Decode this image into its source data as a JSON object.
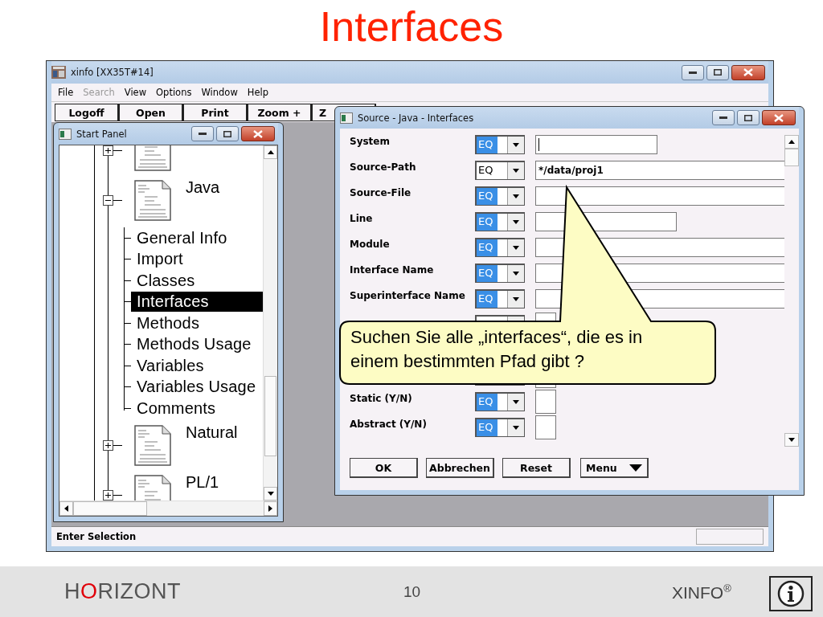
{
  "slide_title": "Interfaces",
  "main_window": {
    "title": "xinfo [XX35T#14]",
    "menu": [
      {
        "label": "File",
        "disabled": false
      },
      {
        "label": "Search",
        "disabled": true
      },
      {
        "label": "View",
        "disabled": false
      },
      {
        "label": "Options",
        "disabled": false
      },
      {
        "label": "Window",
        "disabled": false
      },
      {
        "label": "Help",
        "disabled": false
      }
    ],
    "toolbar": [
      "Logoff",
      "Open",
      "Print",
      "Zoom +",
      "Z"
    ],
    "status_bar": "Enter Selection"
  },
  "start_panel": {
    "title": "Start Panel",
    "tree": [
      {
        "expanded": false
      },
      {
        "label": "Java",
        "expanded": true,
        "children": [
          {
            "label": "General Info",
            "selected": false
          },
          {
            "label": "Import",
            "selected": false
          },
          {
            "label": "Classes",
            "selected": false
          },
          {
            "label": "Interfaces",
            "selected": true
          },
          {
            "label": "Methods",
            "selected": false
          },
          {
            "label": "Methods Usage",
            "selected": false
          },
          {
            "label": "Variables",
            "selected": false
          },
          {
            "label": "Variables Usage",
            "selected": false
          },
          {
            "label": "Comments",
            "selected": false
          }
        ]
      },
      {
        "label": "Natural",
        "expanded": false
      },
      {
        "label": "PL/1",
        "expanded": false
      }
    ]
  },
  "source_window": {
    "title": "Source - Java - Interfaces",
    "fields": [
      {
        "label": "System",
        "operator": "EQ",
        "highlighted": true,
        "kind": "short",
        "cursor": true
      },
      {
        "label": "Source-Path",
        "operator": "EQ",
        "highlighted": false,
        "kind": "long",
        "value": "*/data/proj1"
      },
      {
        "label": "Source-File",
        "operator": "EQ",
        "highlighted": true,
        "kind": "long"
      },
      {
        "label": "Line",
        "operator": "EQ",
        "highlighted": true,
        "kind": "medium"
      },
      {
        "label": "Module",
        "operator": "EQ",
        "highlighted": true,
        "kind": "long"
      },
      {
        "label": "Interface Name",
        "operator": "EQ",
        "highlighted": true,
        "kind": "long"
      },
      {
        "label": "Superinterface Name",
        "operator": "EQ",
        "highlighted": true,
        "kind": "long"
      },
      {
        "kind": "tiny"
      },
      {
        "kind": "covered"
      },
      {
        "kind": "tiny"
      },
      {
        "label": "Static (Y/N)",
        "operator": "EQ",
        "highlighted": true,
        "kind": "tiny"
      },
      {
        "label": "Abstract (Y/N)",
        "operator": "EQ",
        "highlighted": true,
        "kind": "tiny"
      }
    ],
    "buttons": [
      {
        "label": "OK",
        "kind": "plain"
      },
      {
        "label": "Abbrechen",
        "kind": "plain"
      },
      {
        "label": "Reset",
        "kind": "plain"
      },
      {
        "label": "Menu",
        "kind": "menu"
      }
    ]
  },
  "callout": {
    "text": "Suchen Sie alle „interfaces“, die es in einem bestimmten Pfad gibt ?"
  },
  "footer": {
    "logo": {
      "lead": "H",
      "accent": "O",
      "rest": "RIZONT"
    },
    "page": "10",
    "product": "XINFO$^{®}$"
  }
}
